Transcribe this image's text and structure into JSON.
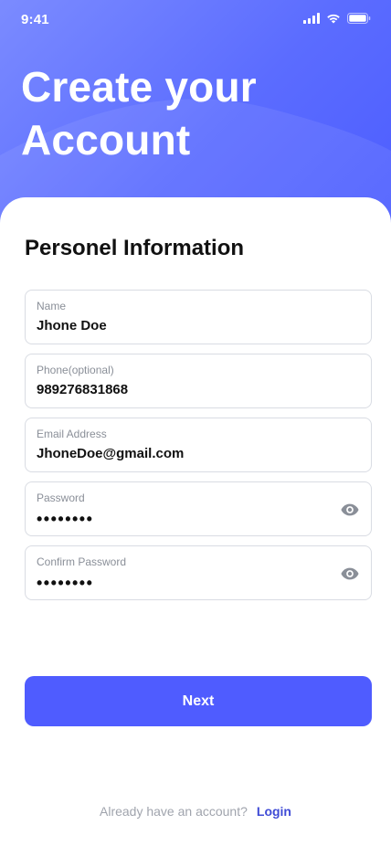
{
  "status_bar": {
    "time": "9:41"
  },
  "header": {
    "title_line1": "Create your",
    "title_line2": "Account"
  },
  "form": {
    "section_title": "Personel Information",
    "fields": [
      {
        "label": "Name",
        "value": "Jhone Doe"
      },
      {
        "label": "Phone(optional)",
        "value": "989276831868"
      },
      {
        "label": "Email Address",
        "value": "JhoneDoe@gmail.com"
      },
      {
        "label": "Password",
        "value": "••••••••",
        "icon": "eye-icon"
      },
      {
        "label": "Confirm Password",
        "value": "••••••••",
        "icon": "eye-icon"
      }
    ],
    "next_label": "Next"
  },
  "footer": {
    "prompt": "Already have an account?",
    "login_label": "Login"
  },
  "colors": {
    "accent": "#4f5cff",
    "header_gradient_start": "#7b8bff",
    "header_gradient_end": "#4c5dff",
    "border": "#d9dce3",
    "muted_text": "#a0a4ad",
    "link": "#3f4bd6"
  }
}
